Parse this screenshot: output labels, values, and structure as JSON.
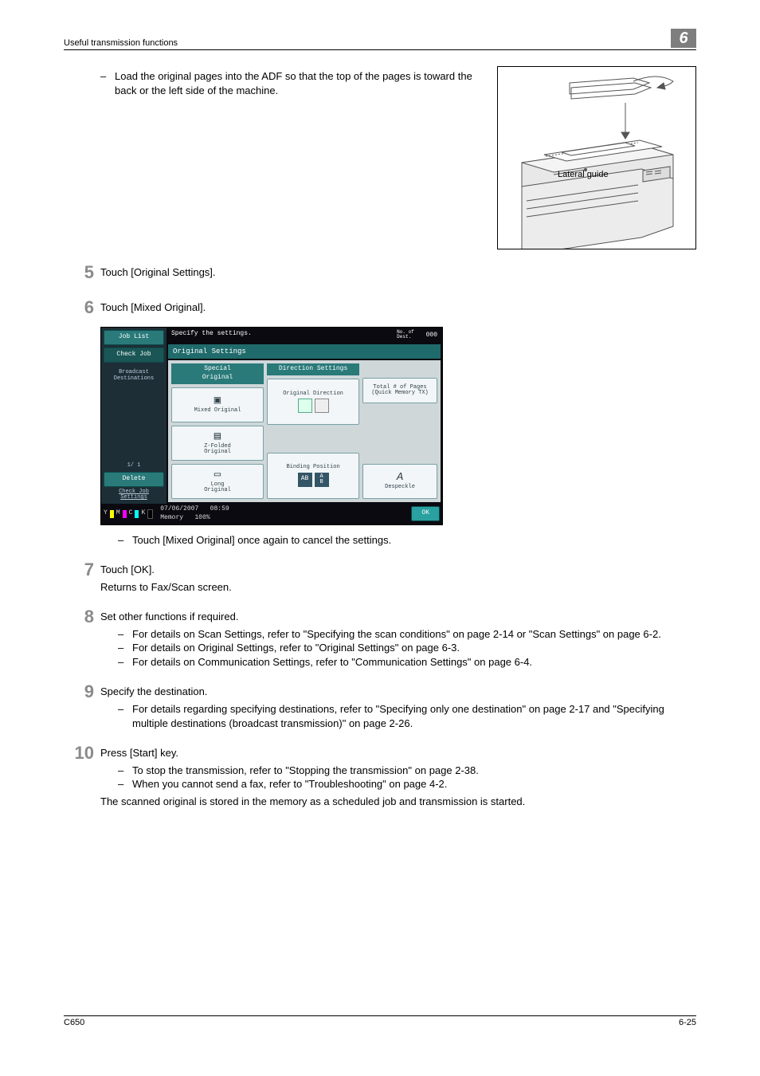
{
  "header": {
    "running": "Useful transmission functions",
    "chapter": "6"
  },
  "adf": {
    "dash": "–",
    "text": "Load the original pages into the ADF so that the top of the pages is toward the back or the left side of the machine.",
    "label": "Lateral guide"
  },
  "steps": {
    "s5": {
      "num": "5",
      "text": "Touch [Original Settings]."
    },
    "s6": {
      "num": "6",
      "text": "Touch [Mixed Original].",
      "note_dash": "–",
      "note": "Touch [Mixed Original] once again to cancel the settings."
    },
    "s7": {
      "num": "7",
      "text": "Touch [OK].",
      "sub": "Returns to Fax/Scan screen."
    },
    "s8": {
      "num": "8",
      "text": "Set other functions if required.",
      "b1_dash": "–",
      "b1": "For details on Scan Settings, refer to \"Specifying the scan conditions\" on page 2-14 or \"Scan Settings\" on page 6-2.",
      "b2_dash": "–",
      "b2": "For details on Original Settings, refer to \"Original Settings\" on page 6-3.",
      "b3_dash": "–",
      "b3": "For details on Communication Settings, refer to \"Communication Settings\" on page 6-4."
    },
    "s9": {
      "num": "9",
      "text": "Specify the destination.",
      "b1_dash": "–",
      "b1": "For details regarding specifying destinations, refer to \"Specifying only one destination\" on page 2-17 and \"Specifying multiple destinations (broadcast transmission)\" on page 2-26."
    },
    "s10": {
      "num": "10",
      "text": "Press [Start] key.",
      "b1_dash": "–",
      "b1": "To stop the transmission, refer to \"Stopping the transmission\" on page 2-38.",
      "b2_dash": "–",
      "b2": "When you cannot send a fax, refer to \"Troubleshooting\" on page 4-2.",
      "tail": "The scanned original is stored in the memory as a scheduled job and transmission is started."
    }
  },
  "panel": {
    "side": {
      "job_list": "Job List",
      "check_job": "Check Job",
      "broadcast": "Broadcast\nDestinations",
      "pager": "1/  1",
      "delete": "Delete",
      "check_settings": "Check Job\nSettings"
    },
    "toner": {
      "y": "Y",
      "m": "M",
      "c": "C",
      "k": "K"
    },
    "head": {
      "specify": "Specify the settings.",
      "dest_label": "No. of\nDest.",
      "dest_count": "000"
    },
    "title": "Original Settings",
    "col1": {
      "head": "Special\nOriginal",
      "mixed": "Mixed Original",
      "zfold": "Z-Folded\nOriginal",
      "long": "Long\nOriginal"
    },
    "col2": {
      "head": "Direction Settings",
      "orig_dir": "Original Direction",
      "bind_pos": "Binding Position"
    },
    "col3": {
      "total": "Total # of Pages\n(Quick Memory TX)",
      "despeckle": "Despeckle"
    },
    "foot": {
      "date": "07/06/2007",
      "time": "08:59",
      "memory": "Memory",
      "pct": "100%",
      "ok": "OK"
    }
  },
  "footer": {
    "model": "C650",
    "page": "6-25"
  }
}
